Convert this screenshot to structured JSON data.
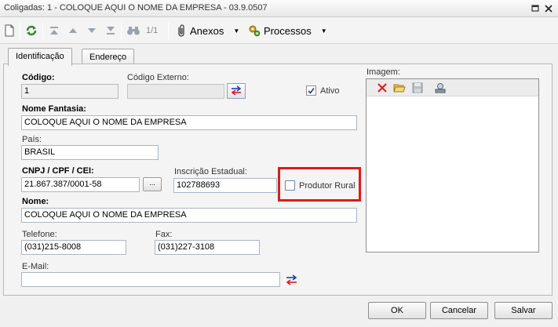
{
  "window": {
    "title": "Coligadas: 1 - COLOQUE AQUI O NOME DA EMPRESA - 03.9.0507",
    "minimize_icon": "minimize-icon",
    "close_icon": "close-icon"
  },
  "toolbar": {
    "page_count": "1/1",
    "attachments_label": "Anexos",
    "processes_label": "Processos"
  },
  "tabs": [
    {
      "label": "Identificação",
      "active": true
    },
    {
      "label": "Endereço",
      "active": false
    }
  ],
  "form": {
    "codigo_label": "Código:",
    "codigo_value": "1",
    "codigo_externo_label": "Código Externo:",
    "codigo_externo_value": "",
    "ativo_label": "Ativo",
    "ativo_checked": true,
    "nome_fantasia_label": "Nome Fantasia:",
    "nome_fantasia_value": "COLOQUE AQUI O NOME DA EMPRESA",
    "pais_label": "País:",
    "pais_value": "BRASIL",
    "cnpj_label": "CNPJ / CPF / CEI:",
    "cnpj_value": "21.867.387/0001-58",
    "cnpj_lookup_label": "...",
    "inscricao_label": "Inscrição Estadual:",
    "inscricao_value": "102788693",
    "produtor_rural_label": "Produtor Rural",
    "produtor_rural_checked": false,
    "nome_label": "Nome:",
    "nome_value": "COLOQUE AQUI O NOME DA EMPRESA",
    "telefone_label": "Telefone:",
    "telefone_value": "(031)215-8008",
    "fax_label": "Fax:",
    "fax_value": "(031)227-3108",
    "email_label": "E-Mail:",
    "email_value": ""
  },
  "image_panel": {
    "label": "Imagem:"
  },
  "footer": {
    "ok_label": "OK",
    "cancel_label": "Cancelar",
    "save_label": "Salvar"
  },
  "colors": {
    "highlight_border": "#e01b1b",
    "input_border": "#a9b6c6"
  }
}
